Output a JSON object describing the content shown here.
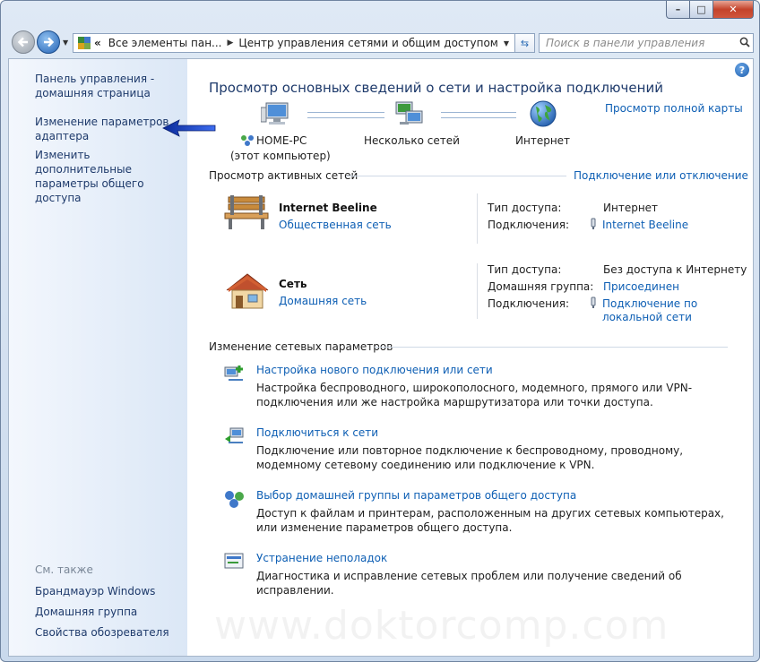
{
  "window": {
    "min_glyph": "–",
    "max_glyph": "□",
    "close_glyph": "✕"
  },
  "address_bar": {
    "segment1": "Все элементы пан...",
    "segment2": "Центр управления сетями и общим доступом",
    "overflow": "«"
  },
  "search": {
    "placeholder": "Поиск в панели управления"
  },
  "sidebar": {
    "home": "Панель управления - домашняя страница",
    "adapter": "Изменение параметров адаптера",
    "sharing": "Изменить дополнительные параметры общего доступа",
    "see_also_label": "См. также",
    "see_also": [
      "Брандмауэр Windows",
      "Домашняя группа",
      "Свойства обозревателя"
    ]
  },
  "main": {
    "title": "Просмотр основных сведений о сети и настройка подключений",
    "full_map": "Просмотр полной карты",
    "map": {
      "computer": "HOME-PC",
      "computer_sub": "(этот компьютер)",
      "networks": "Несколько сетей",
      "internet": "Интернет"
    },
    "active_header": "Просмотр активных сетей",
    "connect_disconnect": "Подключение или отключение",
    "networks": [
      {
        "name": "Internet Beeline",
        "type": "Общественная сеть",
        "access_key": "Тип доступа:",
        "access_val": "Интернет",
        "conn_key": "Подключения:",
        "conn_val": "Internet Beeline"
      },
      {
        "name": "Сеть",
        "type": "Домашняя сеть",
        "access_key": "Тип доступа:",
        "access_val": "Без доступа к Интернету",
        "group_key": "Домашняя группа:",
        "group_val": "Присоединен",
        "conn_key": "Подключения:",
        "conn_val": "Подключение по локальной сети"
      }
    ],
    "change_header": "Изменение сетевых параметров",
    "tasks": [
      {
        "title": "Настройка нового подключения или сети",
        "desc": "Настройка беспроводного, широкополосного, модемного, прямого или VPN-подключения или же настройка маршрутизатора или точки доступа."
      },
      {
        "title": "Подключиться к сети",
        "desc": "Подключение или повторное подключение к беспроводному, проводному, модемному сетевому соединению или подключение к VPN."
      },
      {
        "title": "Выбор домашней группы и параметров общего доступа",
        "desc": "Доступ к файлам и принтерам, расположенным на других сетевых компьютерах, или изменение параметров общего доступа."
      },
      {
        "title": "Устранение неполадок",
        "desc": "Диагностика и исправление сетевых проблем или получение сведений об исправлении."
      }
    ],
    "watermark": "www.doktorcomp.com"
  }
}
